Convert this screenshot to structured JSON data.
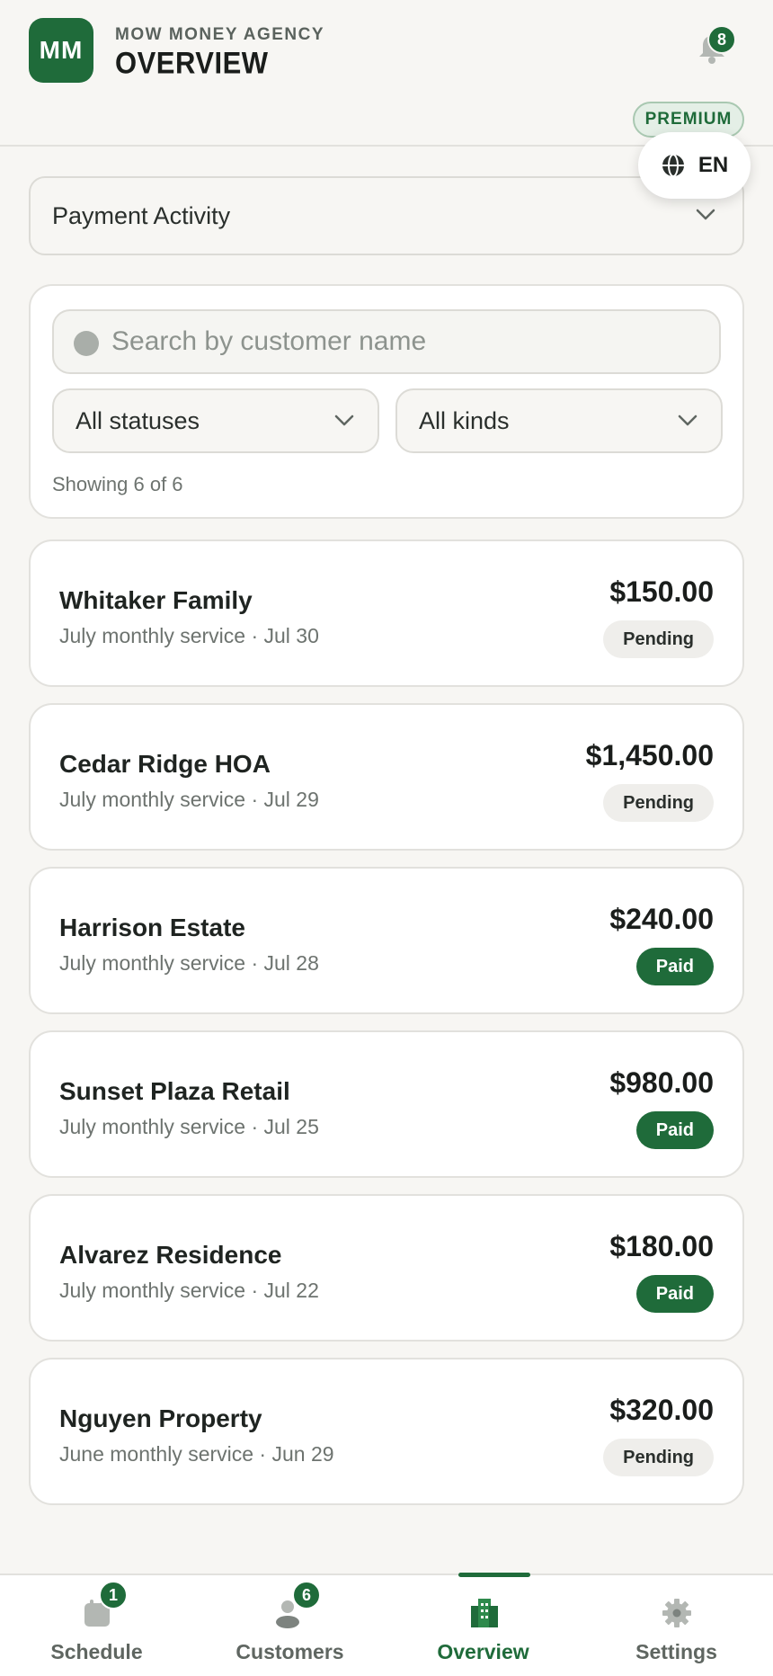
{
  "header": {
    "logo_initials": "MM",
    "agency_name": "MOW MONEY AGENCY",
    "title": "OVERVIEW",
    "notifications_count": "8",
    "plan_badge": "PREMIUM",
    "language": "EN"
  },
  "section_select": {
    "value": "Payment Activity"
  },
  "filters": {
    "search_placeholder": "Search by customer name",
    "status_select": "All statuses",
    "kind_select": "All kinds",
    "showing": "Showing 6 of 6"
  },
  "payments": [
    {
      "customer": "Whitaker Family",
      "detail": "July monthly service · Jul 30",
      "amount": "$150.00",
      "status": "Pending"
    },
    {
      "customer": "Cedar Ridge HOA",
      "detail": "July monthly service · Jul 29",
      "amount": "$1,450.00",
      "status": "Pending"
    },
    {
      "customer": "Harrison Estate",
      "detail": "July monthly service · Jul 28",
      "amount": "$240.00",
      "status": "Paid"
    },
    {
      "customer": "Sunset Plaza Retail",
      "detail": "July monthly service · Jul 25",
      "amount": "$980.00",
      "status": "Paid"
    },
    {
      "customer": "Alvarez Residence",
      "detail": "July monthly service · Jul 22",
      "amount": "$180.00",
      "status": "Paid"
    },
    {
      "customer": "Nguyen Property",
      "detail": "June monthly service · Jun 29",
      "amount": "$320.00",
      "status": "Pending"
    }
  ],
  "bottom_nav": {
    "schedule": {
      "label": "Schedule",
      "badge": "1",
      "icon": "calendar-icon"
    },
    "customers": {
      "label": "Customers",
      "badge": "6",
      "icon": "people-icon"
    },
    "overview": {
      "label": "Overview",
      "icon": "building-icon",
      "active": true
    },
    "settings": {
      "label": "Settings",
      "icon": "gear-icon"
    }
  },
  "colors": {
    "brand_green": "#1f6b3a",
    "background": "#f7f6f3",
    "pending_badge": "#efeeeb"
  }
}
